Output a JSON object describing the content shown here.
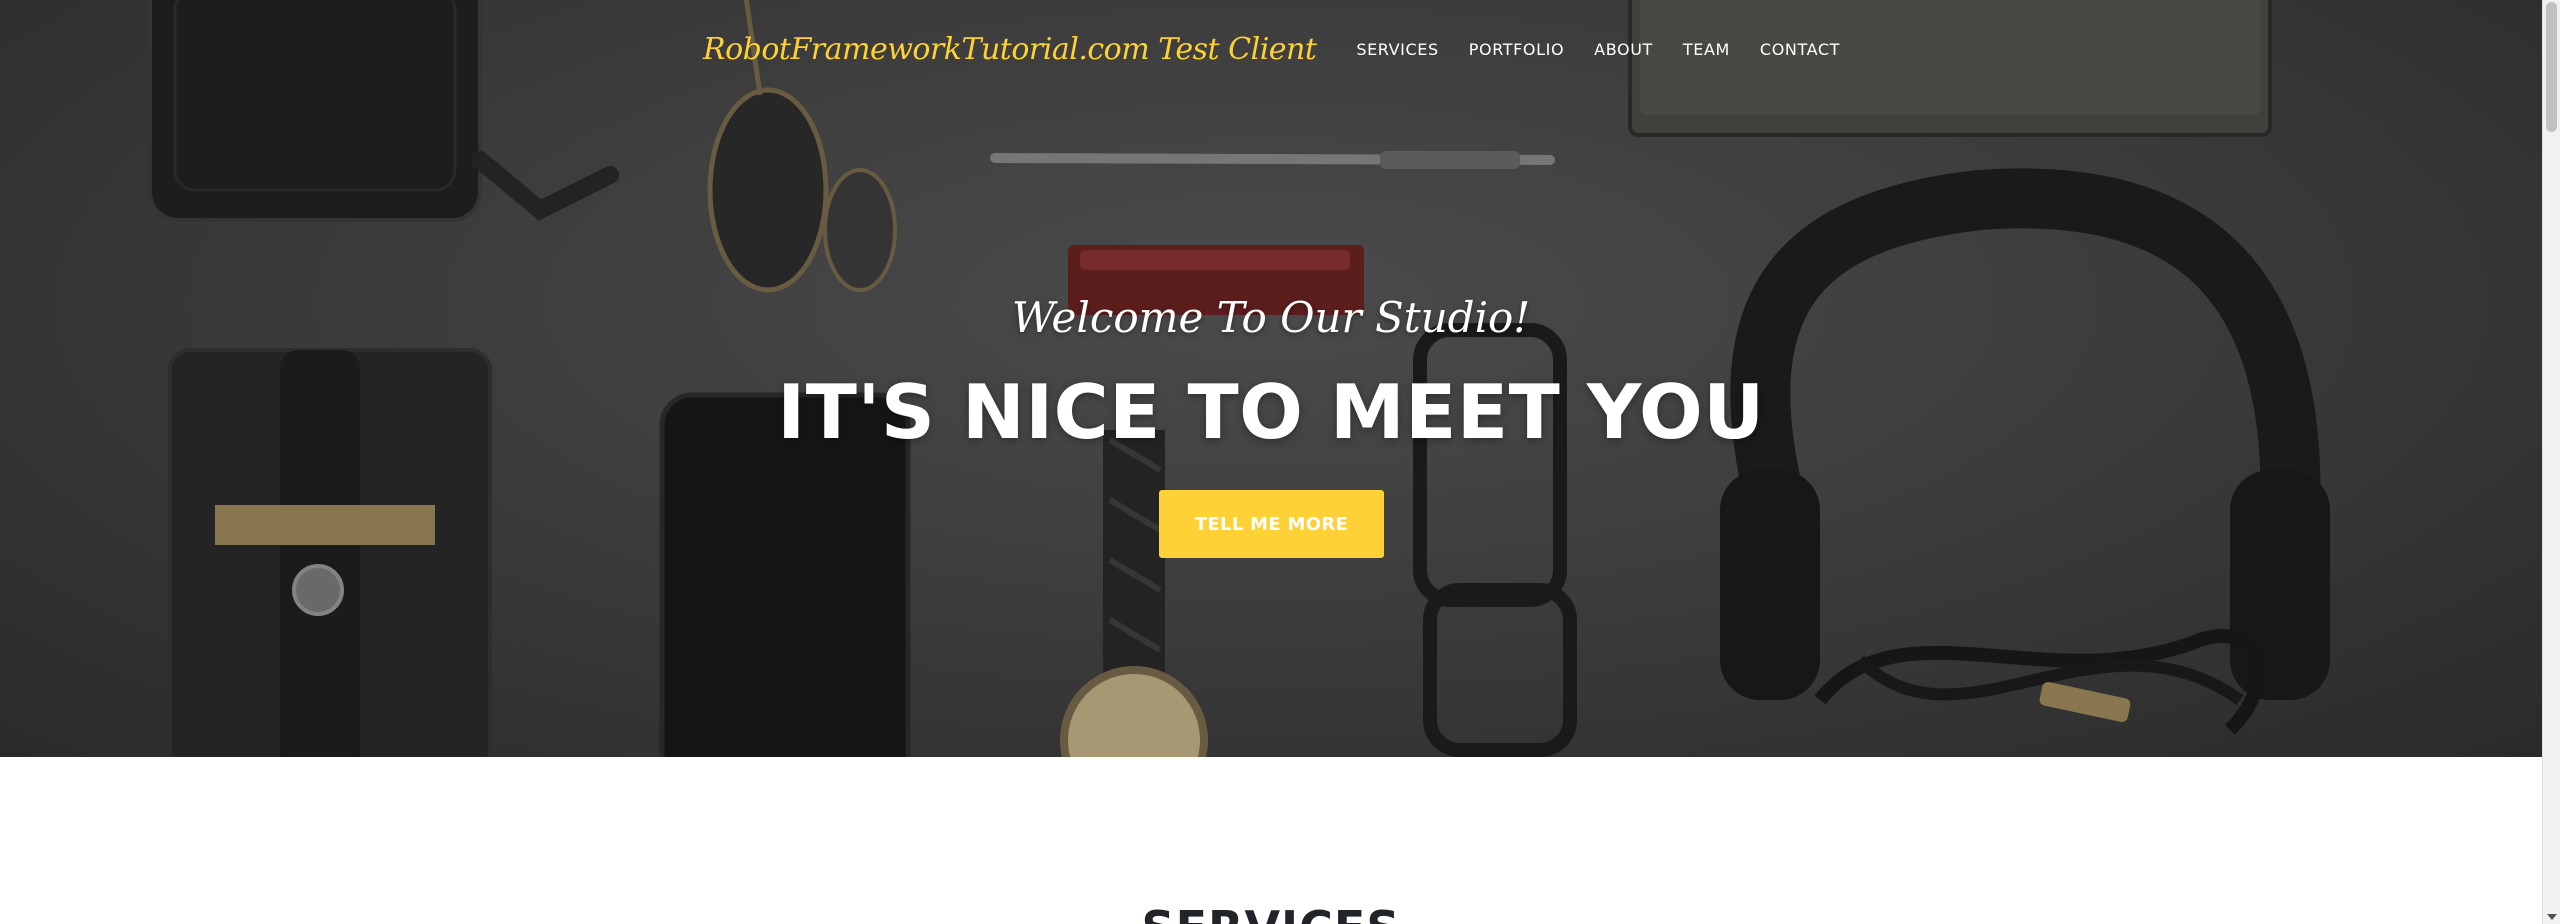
{
  "navbar": {
    "brand": "RobotFrameworkTutorial.com Test Client",
    "items": [
      "SERVICES",
      "PORTFOLIO",
      "ABOUT",
      "TEAM",
      "CONTACT"
    ]
  },
  "hero": {
    "lead_in": "Welcome To Our Studio!",
    "heading": "IT'S NICE TO MEET YOU",
    "cta_label": "TELL ME MORE"
  },
  "services": {
    "title": "SERVICES"
  },
  "colors": {
    "accent": "#fed136",
    "hero_bg": "#454545",
    "text_dark": "#212529"
  }
}
